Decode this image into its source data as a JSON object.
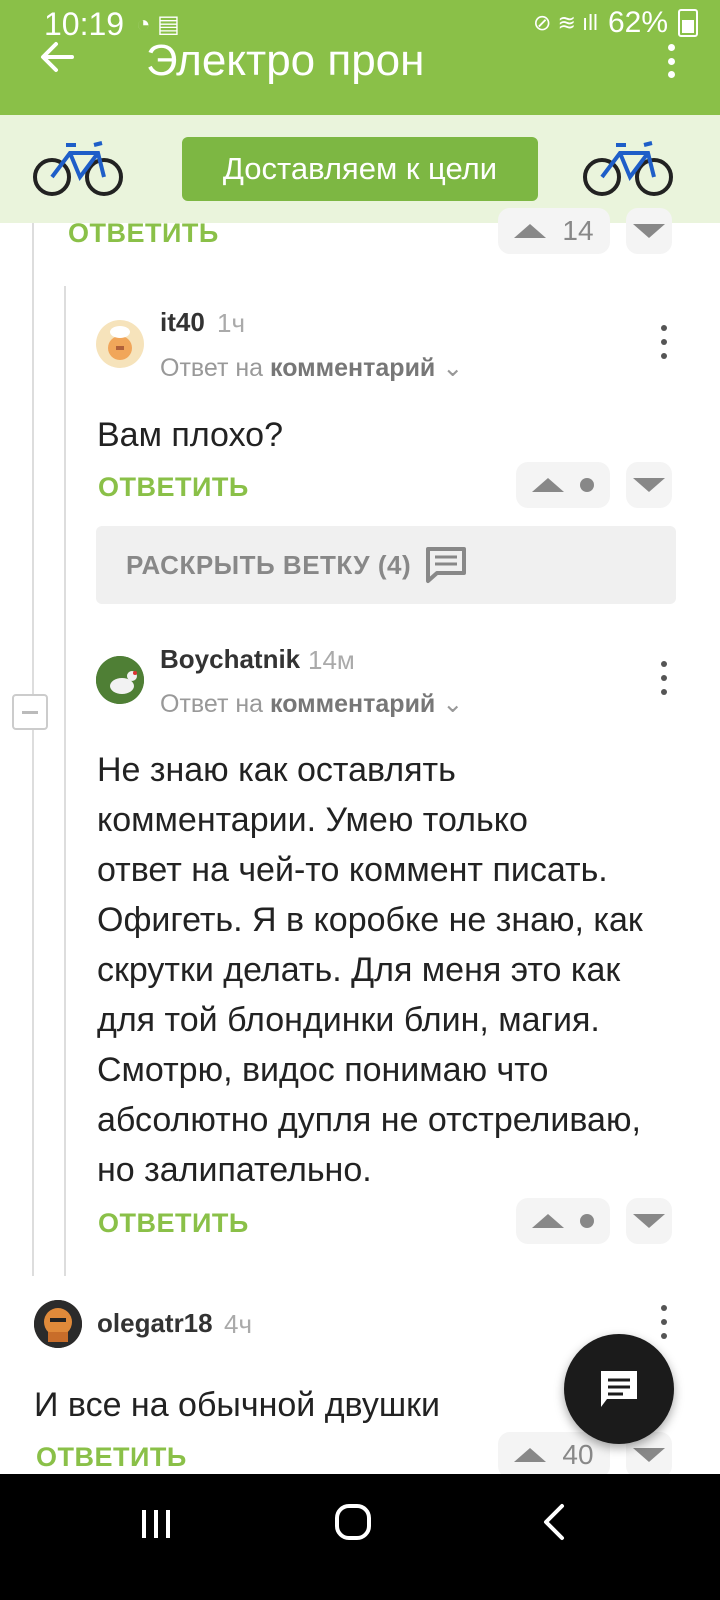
{
  "status_bar": {
    "time": "10:19",
    "battery": "62%"
  },
  "app_bar": {
    "title": "Электро прон"
  },
  "banner": {
    "button_label": "Доставляем к цели"
  },
  "top_partial": {
    "reply_label": "ОТВЕТИТЬ",
    "score": "14"
  },
  "comments": [
    {
      "username": "it40",
      "time": "1ч",
      "reply_to_prefix": "Ответ на",
      "reply_to_target": "комментарий",
      "text": "Вам плохо?",
      "reply_label": "ОТВЕТИТЬ"
    },
    {
      "username": "Boychatnik",
      "time": "14м",
      "reply_to_prefix": "Ответ на",
      "reply_to_target": "комментарий",
      "text_lines": [
        "Не знаю как оставлять",
        "комментарии. Умею только",
        "ответ на чей-то коммент писать.",
        "Офигеть. Я в коробке не знаю, как",
        "скрутки делать. Для меня это как",
        "для той блондинки блин, магия.",
        "Смотрю, видос понимаю что",
        "абсолютно дупля не отстреливаю,",
        "но залипательно."
      ],
      "reply_label": "ОТВЕТИТЬ"
    },
    {
      "username": "olegatr18",
      "time": "4ч",
      "text": "И все на обычной двушки",
      "reply_label": "ОТВЕТИТЬ",
      "score": "40"
    }
  ],
  "expand_branch": {
    "label": "РАСКРЫТЬ ВЕТКУ (4)"
  },
  "colors": {
    "accent": "#8ac048",
    "banner_bg": "#eaf4dc",
    "button": "#7db743"
  }
}
